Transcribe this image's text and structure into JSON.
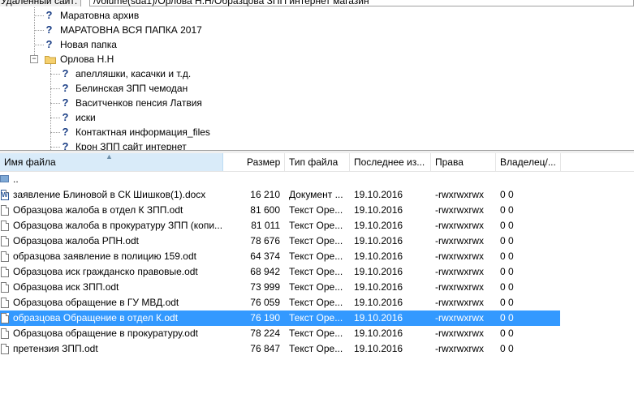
{
  "path_bar": {
    "label": "Удаленный сайт:",
    "value": "/volume(sda1)/Орлова Н.Н/Образцова ЗПП интернет магазин"
  },
  "tree": {
    "items": [
      {
        "label": "Маратовна архив"
      },
      {
        "label": "МАРАТОВНА ВСЯ ПАПКА 2017"
      },
      {
        "label": "Новая папка"
      },
      {
        "label": "Орлова Н.Н"
      },
      {
        "label": "апелляшки, касачки и т.д."
      },
      {
        "label": "Белинская ЗПП чемодан"
      },
      {
        "label": "Васитченков пенсия Латвия"
      },
      {
        "label": "иски"
      },
      {
        "label": "Контактная информация_files"
      },
      {
        "label": "Крон ЗПП сайт интернет"
      }
    ]
  },
  "file_list": {
    "columns": {
      "name": "Имя файла",
      "size": "Размер",
      "type": "Тип файла",
      "modified": "Последнее из...",
      "perms": "Права",
      "owner": "Владелец/..."
    },
    "parent_dir": "..",
    "rows": [
      {
        "name": "заявление Блиновой в СК Шишков(1).docx",
        "size": "16 210",
        "type": "Документ ...",
        "date": "19.10.2016",
        "perms": "-rwxrwxrwx",
        "owner": "0 0",
        "icon": "word-doc-icon"
      },
      {
        "name": "Образцова жалоба в отдел К ЗПП.odt",
        "size": "81 600",
        "type": "Текст Оре...",
        "date": "19.10.2016",
        "perms": "-rwxrwxrwx",
        "owner": "0 0",
        "icon": "document-icon"
      },
      {
        "name": "Образцова жалоба в прокуратуру ЗПП (копи...",
        "size": "81 011",
        "type": "Текст Оре...",
        "date": "19.10.2016",
        "perms": "-rwxrwxrwx",
        "owner": "0 0",
        "icon": "document-icon"
      },
      {
        "name": "Образцова жалоба РПН.odt",
        "size": "78 676",
        "type": "Текст Оре...",
        "date": "19.10.2016",
        "perms": "-rwxrwxrwx",
        "owner": "0 0",
        "icon": "document-icon"
      },
      {
        "name": "образцова заявление в полицию 159.odt",
        "size": "64 374",
        "type": "Текст Оре...",
        "date": "19.10.2016",
        "perms": "-rwxrwxrwx",
        "owner": "0 0",
        "icon": "document-icon"
      },
      {
        "name": "Образцова иск гражданско правовые.odt",
        "size": "68 942",
        "type": "Текст Оре...",
        "date": "19.10.2016",
        "perms": "-rwxrwxrwx",
        "owner": "0 0",
        "icon": "document-icon"
      },
      {
        "name": "Образцова иск ЗПП.odt",
        "size": "73 999",
        "type": "Текст Оре...",
        "date": "19.10.2016",
        "perms": "-rwxrwxrwx",
        "owner": "0 0",
        "icon": "document-icon"
      },
      {
        "name": "Образцова обращение в ГУ МВД.odt",
        "size": "76 059",
        "type": "Текст Оре...",
        "date": "19.10.2016",
        "perms": "-rwxrwxrwx",
        "owner": "0 0",
        "icon": "document-icon"
      },
      {
        "name": "образцова Обращение в отдел К.odt",
        "size": "76 190",
        "type": "Текст Оре...",
        "date": "19.10.2016",
        "perms": "-rwxrwxrwx",
        "owner": "0 0",
        "icon": "document-icon",
        "selected": true
      },
      {
        "name": "Образцова обращение в прокуратуру.odt",
        "size": "78 224",
        "type": "Текст Оре...",
        "date": "19.10.2016",
        "perms": "-rwxrwxrwx",
        "owner": "0 0",
        "icon": "document-icon"
      },
      {
        "name": "претензия ЗПП.odt",
        "size": "76 847",
        "type": "Текст Оре...",
        "date": "19.10.2016",
        "perms": "-rwxrwxrwx",
        "owner": "0 0",
        "icon": "document-icon"
      }
    ]
  },
  "colors": {
    "selection": "#3399ff",
    "sorted_header": "#d9ebf9",
    "folder_question_icon": "#1b3f86"
  }
}
